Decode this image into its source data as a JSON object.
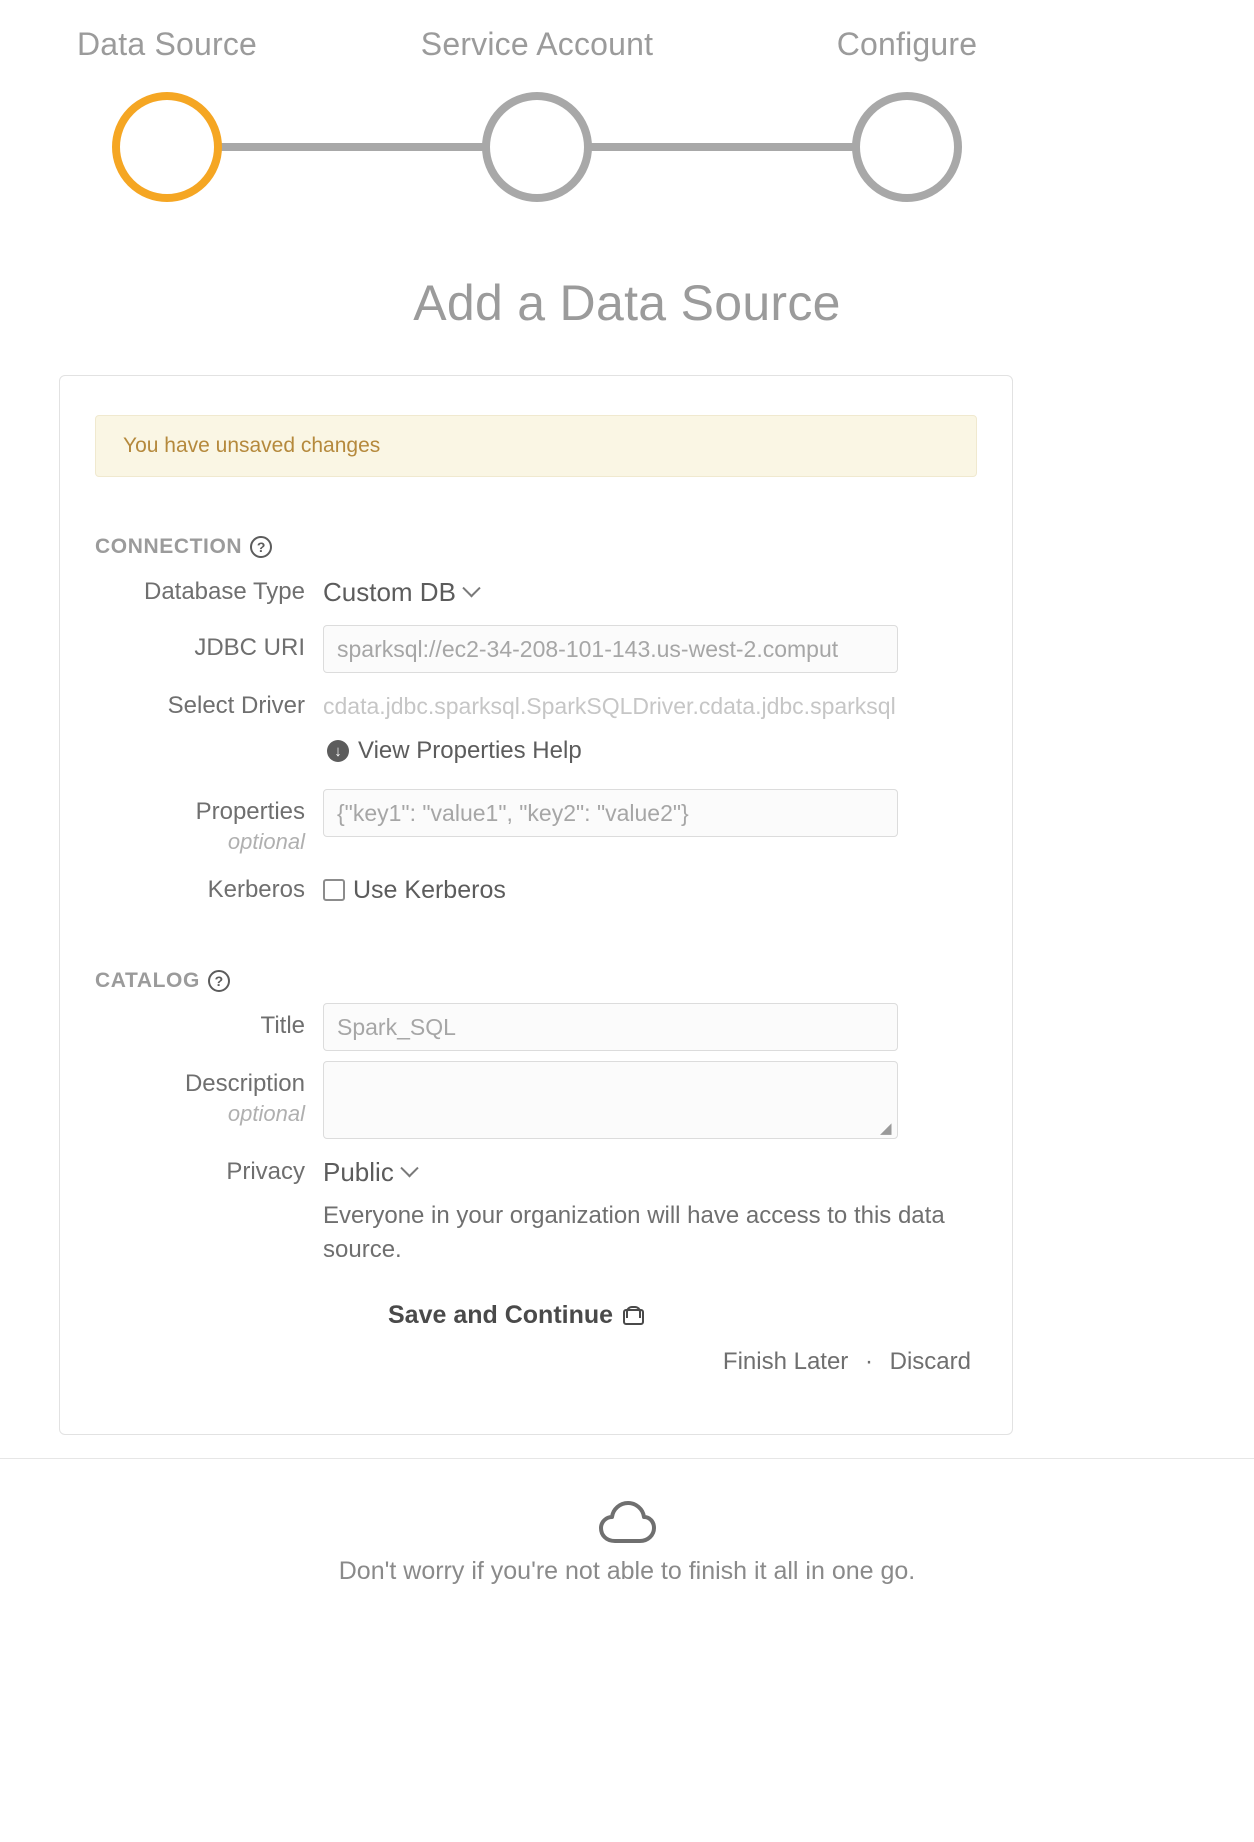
{
  "stepper": {
    "steps": [
      {
        "label": "Data Source",
        "state": "active"
      },
      {
        "label": "Service Account",
        "state": "inactive"
      },
      {
        "label": "Configure",
        "state": "inactive"
      }
    ],
    "active_color": "#f5a623",
    "inactive_color": "#a8a8a8"
  },
  "page": {
    "title": "Add a Data Source"
  },
  "alert": {
    "message": "You have unsaved changes",
    "text_color": "#b5893c",
    "background_color": "#faf6e4"
  },
  "connection": {
    "heading": "CONNECTION",
    "help_icon": "question-circle-icon",
    "database_type": {
      "label": "Database Type",
      "value": "Custom DB"
    },
    "jdbc_uri": {
      "label": "JDBC URI",
      "value": "sparksql://ec2-34-208-101-143.us-west-2.comput"
    },
    "select_driver": {
      "label": "Select Driver",
      "value": "cdata.jdbc.sparksql.SparkSQLDriver.cdata.jdbc.sparksql"
    },
    "properties_help_link": {
      "label": "View Properties Help",
      "icon": "download-circle-icon"
    },
    "properties": {
      "label": "Properties",
      "optional_note": "optional",
      "placeholder": "{\"key1\": \"value1\", \"key2\": \"value2\"}"
    },
    "kerberos": {
      "label": "Kerberos",
      "checkbox_label": "Use Kerberos",
      "checked": false
    }
  },
  "catalog": {
    "heading": "CATALOG",
    "help_icon": "question-circle-icon",
    "title_field": {
      "label": "Title",
      "value": "Spark_SQL"
    },
    "description_field": {
      "label": "Description",
      "optional_note": "optional",
      "value": ""
    },
    "privacy": {
      "label": "Privacy",
      "value": "Public",
      "description": "Everyone in your organization will have access to this data source."
    }
  },
  "actions": {
    "save_label": "Save and Continue",
    "save_icon": "lock-icon",
    "finish_later_label": "Finish Later",
    "separator": "·",
    "discard_label": "Discard"
  },
  "footer": {
    "icon": "cloud-icon",
    "message": "Don't worry if you're not able to finish it all in one go."
  }
}
